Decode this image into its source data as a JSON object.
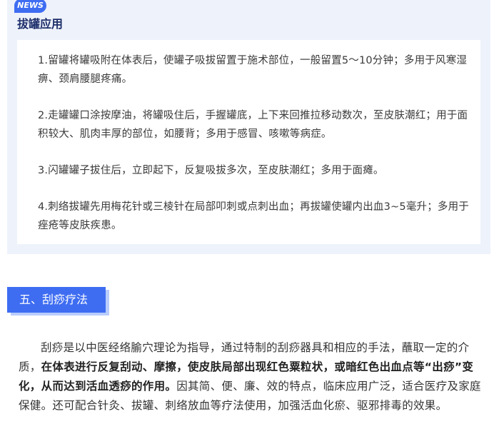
{
  "news_card": {
    "badge": "NEWS",
    "title": "拔罐应用",
    "items": [
      "1.留罐将罐吸附在体表后，使罐子吸拔留置于施术部位，一般留置5～10分钟；多用于风寒湿痹、颈肩腰腿疼痛。",
      "2.走罐罐口涂按摩油，将罐吸住后，手握罐底，上下来回推拉移动数次，至皮肤潮红；用于面积较大、肌肉丰厚的部位，如腰背；多用于感冒、咳嗽等病症。",
      "3.闪罐罐子拔住后，立即起下，反复吸拔多次，至皮肤潮红；多用于面瘫。",
      "4.刺络拔罐先用梅花针或三棱针在局部叩刺或点刺出血；再拔罐使罐内出血3~5毫升；多用于痤疮等皮肤疾患。"
    ]
  },
  "section": {
    "header": "五、刮痧疗法",
    "paragraph": {
      "part1": "刮痧是以中医经络腧穴理论为指导，通过特制的刮痧器具和相应的手法，蘸取一定的介质，",
      "bold": "在体表进行反复刮动、摩擦，使皮肤局部出现红色粟粒状，或暗红色出血点等“出痧”变化，从而达到活血透痧的作用。",
      "part2": "因其简、便、廉、效的特点，临床应用广泛，适合医疗及家庭保健。还可配合针灸、拔罐、刺络放血等疗法使用，加强活血化瘀、驱邪排毒的效果。"
    }
  }
}
